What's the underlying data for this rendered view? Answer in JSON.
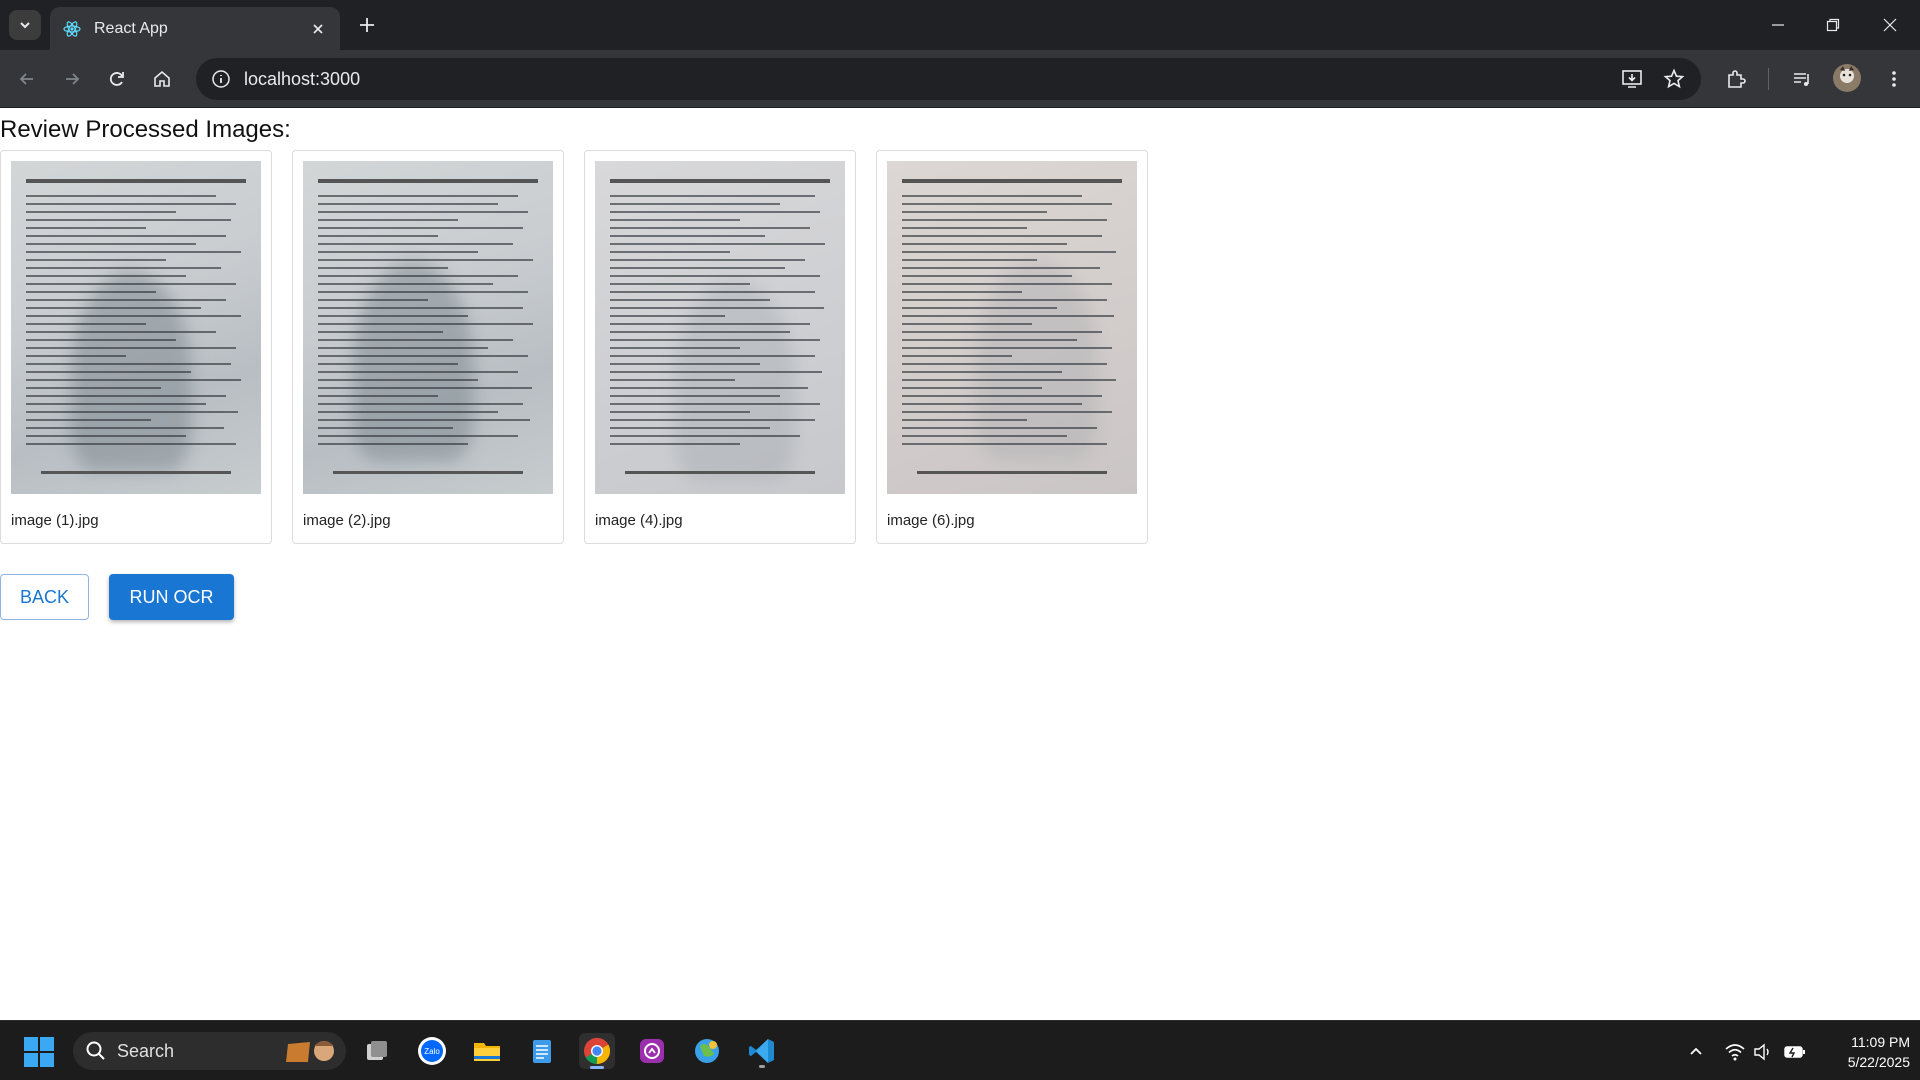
{
  "browser": {
    "tab_title": "React App",
    "url": "localhost:3000"
  },
  "page": {
    "title": "Review Processed Images:",
    "images": [
      {
        "filename": "image (1).jpg"
      },
      {
        "filename": "image (2).jpg"
      },
      {
        "filename": "image (4).jpg"
      },
      {
        "filename": "image (6).jpg"
      }
    ],
    "back_label": "BACK",
    "run_label": "RUN OCR"
  },
  "taskbar": {
    "search_label": "Search",
    "time": "11:09 PM",
    "date": "5/22/2025",
    "apps": [
      "task-view",
      "zalo",
      "file-explorer",
      "notepad",
      "chrome",
      "messenger",
      "network-app",
      "vscode"
    ]
  },
  "colors": {
    "primary": "#1976d2",
    "chrome_dark": "#202124",
    "chrome_toolbar": "#35363a",
    "taskbar": "#1c1c1c"
  }
}
